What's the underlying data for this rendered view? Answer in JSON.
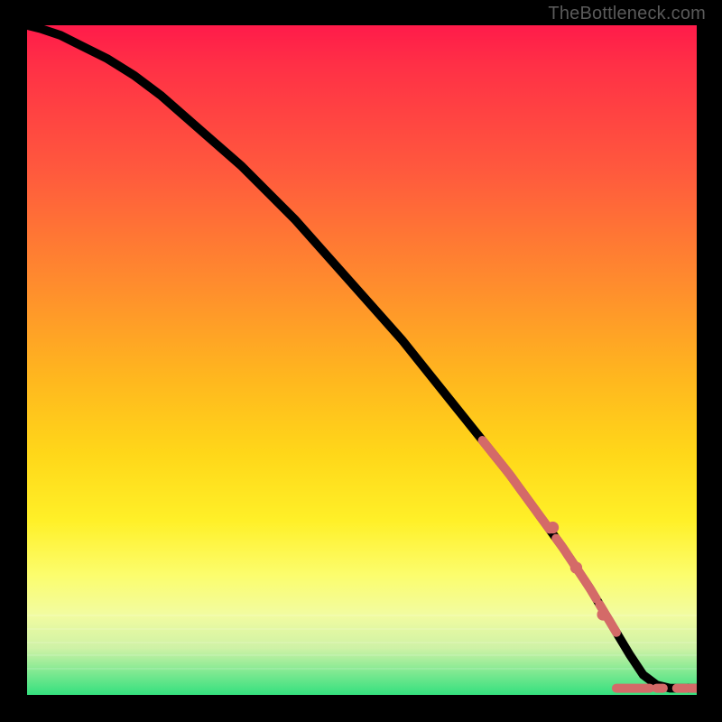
{
  "watermark": "TheBottleneck.com",
  "colors": {
    "background": "#000000",
    "curve": "#000000",
    "highlight": "#d46a68"
  },
  "chart_data": {
    "type": "line",
    "title": "",
    "xlabel": "",
    "ylabel": "",
    "xlim": [
      0,
      100
    ],
    "ylim": [
      0,
      100
    ],
    "grid": false,
    "series": [
      {
        "name": "curve",
        "x": [
          0,
          2,
          5,
          8,
          12,
          16,
          20,
          24,
          28,
          32,
          36,
          40,
          44,
          48,
          52,
          56,
          60,
          64,
          68,
          72,
          76,
          80,
          84,
          87,
          90,
          92,
          94,
          96,
          98,
          100
        ],
        "y": [
          100,
          99.5,
          98.5,
          97,
          95,
          92.5,
          89.5,
          86,
          82.5,
          79,
          75,
          71,
          66.5,
          62,
          57.5,
          53,
          48,
          43,
          38,
          33,
          27.5,
          22,
          16,
          11,
          6,
          3,
          1.5,
          1,
          1,
          1
        ]
      }
    ],
    "highlight_segments": [
      {
        "from_x": 68,
        "to_x": 78
      },
      {
        "from_x": 79,
        "to_x": 85
      },
      {
        "from_x": 85.5,
        "to_x": 88
      }
    ],
    "highlight_points": [
      {
        "x": 78.5,
        "y": 25
      },
      {
        "x": 82,
        "y": 19
      },
      {
        "x": 86,
        "y": 12
      }
    ],
    "baseline_segments": [
      {
        "from_x": 88,
        "to_x": 93
      },
      {
        "from_x": 94,
        "to_x": 95
      },
      {
        "from_x": 97,
        "to_x": 98.5
      },
      {
        "from_x": 99,
        "to_x": 100
      }
    ],
    "bottom_bands_y": [
      88,
      90,
      92,
      94,
      96
    ]
  }
}
